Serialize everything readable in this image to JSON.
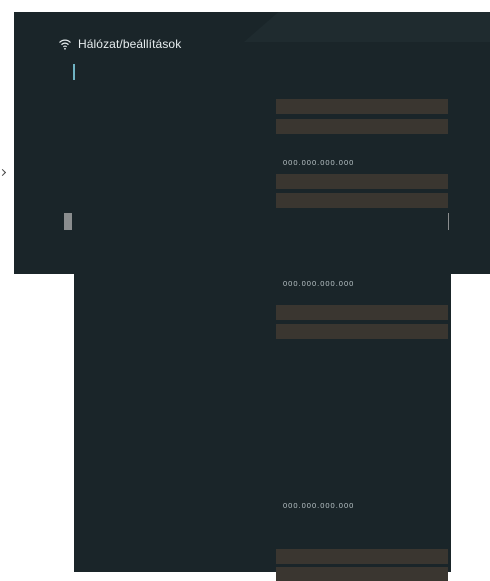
{
  "header": {
    "title": "Hálózat/beállítások",
    "icon": "wifi-icon"
  },
  "ip_fields": [
    {
      "label": "000.000.000.000"
    },
    {
      "label": "000.000.000.000"
    },
    {
      "label": "000.000.000.000"
    }
  ],
  "colors": {
    "panel": "#1a2529",
    "field": "#3a3630",
    "text": "#e6ecee",
    "accent": "#6fb3c3"
  }
}
